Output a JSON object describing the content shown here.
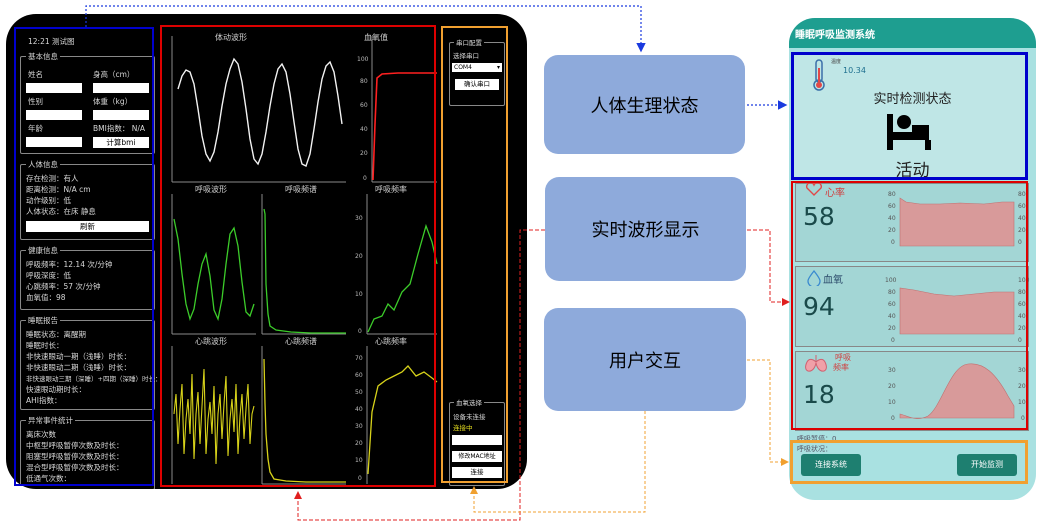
{
  "desktop": {
    "header": "12:21 测试图",
    "basic_info": {
      "title": "基本信息",
      "name_label": "姓名",
      "height_label": "身高（cm）",
      "gender_label": "性别",
      "weight_label": "体重（kg）",
      "age_label": "年龄",
      "bmi_label": "BMI指数： N/A",
      "bmi_button": "计算bmi"
    },
    "body_info": {
      "title": "人体信息",
      "lines": [
        "存在检测：有人",
        "距离检测：N/A cm",
        "动作级别：低",
        "人体状态：在床 静息"
      ],
      "button": "刷新"
    },
    "health_info": {
      "title": "健康信息",
      "lines": [
        "呼吸频率：12.14 次/分钟",
        "呼吸深度：低",
        "心跳频率：57 次/分钟",
        "血氧值：98"
      ]
    },
    "sleep_report": {
      "title": "睡眠报告",
      "lines": [
        "睡眠状态：离醒期",
        "睡眠时长：",
        "非快速眼动一期（浅睡）时长：",
        "非快速眼动二期（浅睡）时长：",
        "非快速眼动三期（深睡）+四期（深睡）时长：",
        "快速眼动期时长：",
        "AHI指数："
      ]
    },
    "events": {
      "title": "异常事件统计",
      "lines": [
        "离床次数",
        "中枢型呼吸暂停次数及时长：",
        "阻塞型呼吸暂停次数及时长：",
        "混合型呼吸暂停次数及时长：",
        "低通气次数："
      ]
    },
    "right_panel": {
      "serial_title": "串口配置",
      "serial_port_label": "选择串口",
      "serial_port_value": "COM4",
      "confirm_button": "确认串口",
      "oximeter_title": "血氧选择",
      "device_label": "设备未连接",
      "status_label": "连接中",
      "mac_button": "修改MAC地址",
      "connect_button": "连接"
    },
    "plots": {
      "body_wave": "体动波形",
      "spo2": "血氧值",
      "resp_wave": "呼吸波形",
      "resp_spectrum": "呼吸频谱",
      "resp_rate": "呼吸频率",
      "heart_wave": "心跳波形",
      "heart_spectrum": "心跳频谱",
      "heart_rate": "心跳频率",
      "spo2_ticks": [
        "100",
        "80",
        "60",
        "40",
        "20",
        "0"
      ],
      "resp_rate_ticks": [
        "30",
        "20",
        "10",
        "0"
      ],
      "heart_rate_ticks": [
        "70",
        "60",
        "50",
        "40",
        "30",
        "20",
        "10",
        "0"
      ]
    }
  },
  "middle": {
    "box1": "人体生理状态",
    "box2": "实时波形显示",
    "box3": "用户交互"
  },
  "phone": {
    "title": "睡眠呼吸监测系统",
    "temp_label": "温度",
    "temp_value": "10.34",
    "status_heading": "实时检测状态",
    "status_value": "活动",
    "heart_label": "心率",
    "heart_value": "58",
    "spo2_label": "血氧",
    "spo2_value": "94",
    "resp_label": "呼吸",
    "resp_label2": "频率",
    "resp_value": "18",
    "heart_ticks": [
      "80",
      "60",
      "40",
      "20",
      "0"
    ],
    "spo2_ticks": [
      "100",
      "80",
      "60",
      "40",
      "20",
      "0"
    ],
    "resp_ticks": [
      "30",
      "20",
      "10",
      "0"
    ],
    "footer_lines": [
      "呼吸暂停：0",
      "呼吸状况："
    ],
    "connect_button": "连接系统",
    "start_button": "开始监测"
  },
  "colors": {
    "blue_frame": "#0000cc",
    "red_frame": "#dd0000",
    "orange_frame": "#f0a030",
    "middle_box": "#8eaadb",
    "phone_bg": "#a9e1e1",
    "chart_fill": "#d89a9a",
    "button_green": "#1e7f70"
  }
}
